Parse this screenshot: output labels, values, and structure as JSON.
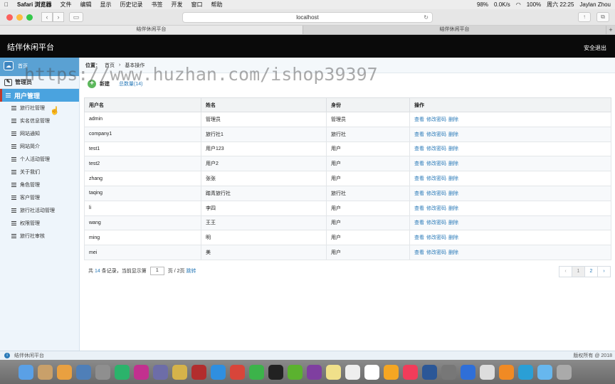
{
  "menubar": {
    "apple": "",
    "items": [
      "Safari 浏览器",
      "文件",
      "编辑",
      "显示",
      "历史记录",
      "书签",
      "开发",
      "窗口",
      "帮助"
    ],
    "battery": "98%",
    "net": "0.0K/s",
    "wifi_battery": "100%",
    "clock": "周六 22:25",
    "user": "Jaylan Zhou"
  },
  "browser": {
    "url": "localhost",
    "tabs": [
      "结伴休闲平台",
      "结伴休闲平台"
    ],
    "new_tab": "+"
  },
  "header": {
    "title": "结伴休闲平台",
    "logout": "安全退出"
  },
  "sidebar": {
    "home": "首页",
    "admin": "管理员",
    "active": "用户管理",
    "items": [
      "旅行社管理",
      "实名信息管理",
      "网站通知",
      "网站简介",
      "个人活动管理",
      "关于我们",
      "角色管理",
      "客户管理",
      "旅行社活动管理",
      "权限管理",
      "旅行社审核"
    ]
  },
  "breadcrumb": {
    "label": "位置：",
    "home": "首页",
    "sep": "›",
    "current": "基本操作"
  },
  "actions": {
    "new": "新建",
    "total": "总数量(14)"
  },
  "table": {
    "headers": [
      "用户名",
      "姓名",
      "身份",
      "操作"
    ],
    "ops": [
      "查看",
      "修改密码",
      "删除"
    ],
    "rows": [
      [
        "admin",
        "管理员",
        "管理员"
      ],
      [
        "company1",
        "旅行社1",
        "旅行社"
      ],
      [
        "test1",
        "用户123",
        "用户"
      ],
      [
        "test2",
        "用户2",
        "用户"
      ],
      [
        "zhang",
        "张张",
        "用户"
      ],
      [
        "taqing",
        "踏青旅行社",
        "旅行社"
      ],
      [
        "li",
        "李四",
        "用户"
      ],
      [
        "wang",
        "王王",
        "用户"
      ],
      [
        "ming",
        "明",
        "用户"
      ],
      [
        "mei",
        "美",
        "用户"
      ]
    ]
  },
  "pager": {
    "prefix": "共",
    "count": "14",
    "mid": "条记录，当前显示第",
    "page": "1",
    "suffix": "页 / 2页",
    "jump": "跳转",
    "prev": "‹",
    "pages": [
      "1",
      "2"
    ],
    "next": "›"
  },
  "status": {
    "left": "结伴休闲平台",
    "right": "版权所有 @ 2018"
  },
  "watermark": "https://www.huzhan.com/ishop39397",
  "colors": {
    "accent": "#4aa3df",
    "header_bg": "#0a0a0a",
    "link": "#2a7ab8",
    "sidebar_bg": "#eef5fb"
  },
  "dock_icons": [
    "finder",
    "notes",
    "photos",
    "preview",
    "launchpad",
    "pycharm",
    "intellij",
    "sequel",
    "db",
    "redis",
    "safari",
    "screen",
    "wechat",
    "qq",
    "green",
    "rp",
    "note",
    "list",
    "calendar",
    "pages",
    "music",
    "word",
    "settings",
    "baidu",
    "pen",
    "sublime",
    "browser",
    "folder",
    "trash"
  ]
}
